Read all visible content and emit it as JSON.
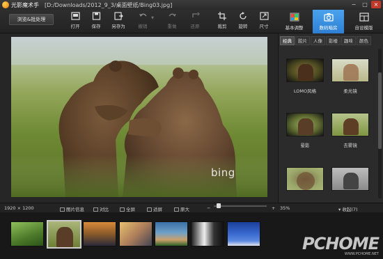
{
  "titlebar": {
    "app_name": "光影魔术手",
    "path": "[D:/Downloads/2012_9_3/桌面壁纸/Bing03.jpg]",
    "min": "−",
    "max": "□",
    "close": "×"
  },
  "toolbar": {
    "batch_label": "浏览&批处理",
    "tools": [
      {
        "label": "打开",
        "icon": "open-icon"
      },
      {
        "label": "保存",
        "icon": "save-icon"
      },
      {
        "label": "另存为",
        "icon": "save-as-icon"
      },
      {
        "label": "撤销",
        "icon": "undo-icon"
      },
      {
        "label": "重做",
        "icon": "redo-icon"
      },
      {
        "label": "还原",
        "icon": "restore-icon"
      },
      {
        "label": "裁剪",
        "icon": "crop-icon"
      },
      {
        "label": "旋转",
        "icon": "rotate-icon"
      },
      {
        "label": "尺寸",
        "icon": "resize-icon"
      }
    ],
    "modes": [
      {
        "label": "基本调整",
        "icon": "adjust-icon"
      },
      {
        "label": "数码暗房",
        "icon": "camera-icon"
      },
      {
        "label": "自设模版",
        "icon": "template-icon"
      }
    ]
  },
  "photo": {
    "watermark": "bing"
  },
  "panel": {
    "tabs": [
      "经典",
      "胶片",
      "人像",
      "影楼",
      "趣味",
      "颜色"
    ],
    "effects": [
      {
        "label": "LOMO风格"
      },
      {
        "label": "柔光镜"
      },
      {
        "label": "晕影"
      },
      {
        "label": "去雾镜"
      },
      {
        "label": ""
      },
      {
        "label": ""
      }
    ]
  },
  "status": {
    "dimensions": "1920 × 1200",
    "info": "图片信息",
    "compare": "对比",
    "fullscreen": "全屏",
    "fit": "适屏",
    "original": "原大",
    "zoom_minus": "−",
    "zoom_plus": "+",
    "zoom": "35%",
    "collapse": "收起(7)",
    "zoom_level": 0.35
  },
  "filmstrip": {
    "count": 7,
    "selected_index": 1,
    "watermark_big": "PCHOME",
    "watermark_small": "WWW.PCHOME.NET"
  },
  "colors": {
    "accent": "#2e7fd3",
    "background": "#1f1f1f"
  }
}
